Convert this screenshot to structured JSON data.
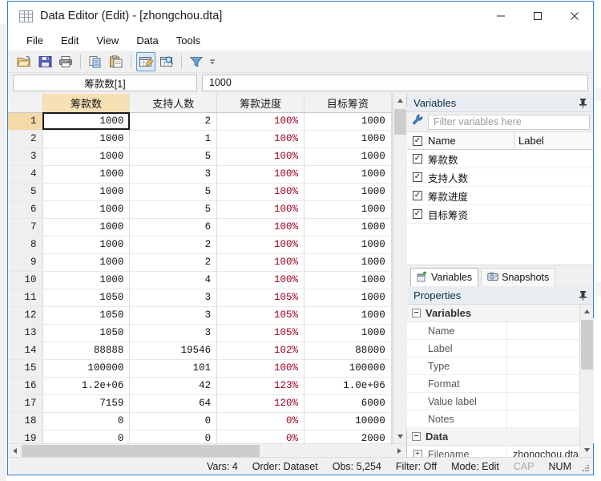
{
  "window": {
    "title": "Data Editor (Edit) - [zhongchou.dta]",
    "icon": "grid-icon",
    "controls": {
      "minimize": "—",
      "maximize": "□",
      "close": "✕"
    }
  },
  "menu": {
    "items": [
      "File",
      "Edit",
      "View",
      "Data",
      "Tools"
    ]
  },
  "toolbar": {
    "buttons": [
      {
        "name": "open-icon",
        "title": "Open"
      },
      {
        "name": "save-icon",
        "title": "Save"
      },
      {
        "name": "print-icon",
        "title": "Print"
      },
      {
        "name": "copy-icon",
        "title": "Copy"
      },
      {
        "name": "paste-icon",
        "title": "Paste"
      },
      {
        "name": "data-editor-edit-icon",
        "title": "Data Editor (Edit)"
      },
      {
        "name": "data-editor-browse-icon",
        "title": "Data Editor (Browse)"
      },
      {
        "name": "filter-icon",
        "title": "Filter"
      }
    ]
  },
  "cellbar": {
    "reference": "筹款数[1]",
    "value": "1000"
  },
  "grid": {
    "columns": [
      "筹款数",
      "支持人数",
      "筹款进度",
      "目标筹资"
    ],
    "selected_column_index": 0,
    "selected_row": 1,
    "rows": [
      {
        "n": "1",
        "c": [
          "1000",
          "2",
          "100%",
          "1000"
        ]
      },
      {
        "n": "2",
        "c": [
          "1000",
          "1",
          "100%",
          "1000"
        ]
      },
      {
        "n": "3",
        "c": [
          "1000",
          "5",
          "100%",
          "1000"
        ]
      },
      {
        "n": "4",
        "c": [
          "1000",
          "3",
          "100%",
          "1000"
        ]
      },
      {
        "n": "5",
        "c": [
          "1000",
          "5",
          "100%",
          "1000"
        ]
      },
      {
        "n": "6",
        "c": [
          "1000",
          "5",
          "100%",
          "1000"
        ]
      },
      {
        "n": "7",
        "c": [
          "1000",
          "6",
          "100%",
          "1000"
        ]
      },
      {
        "n": "8",
        "c": [
          "1000",
          "2",
          "100%",
          "1000"
        ]
      },
      {
        "n": "9",
        "c": [
          "1000",
          "2",
          "100%",
          "1000"
        ]
      },
      {
        "n": "10",
        "c": [
          "1000",
          "4",
          "100%",
          "1000"
        ]
      },
      {
        "n": "11",
        "c": [
          "1050",
          "3",
          "105%",
          "1000"
        ]
      },
      {
        "n": "12",
        "c": [
          "1050",
          "3",
          "105%",
          "1000"
        ]
      },
      {
        "n": "13",
        "c": [
          "1050",
          "3",
          "105%",
          "1000"
        ]
      },
      {
        "n": "14",
        "c": [
          "88888",
          "19546",
          "102%",
          "88000"
        ]
      },
      {
        "n": "15",
        "c": [
          "100000",
          "101",
          "100%",
          "100000"
        ]
      },
      {
        "n": "16",
        "c": [
          "1.2e+06",
          "42",
          "123%",
          "1.0e+06"
        ]
      },
      {
        "n": "17",
        "c": [
          "7159",
          "64",
          "120%",
          "6000"
        ]
      },
      {
        "n": "18",
        "c": [
          "0",
          "0",
          "0%",
          "10000"
        ]
      },
      {
        "n": "19",
        "c": [
          "0",
          "0",
          "0%",
          "2000"
        ]
      }
    ]
  },
  "variables_panel": {
    "title": "Variables",
    "filter_placeholder": "Filter variables here",
    "filter_value": "",
    "columns": {
      "name": "Name",
      "label": "Label"
    },
    "rows": [
      {
        "name": "筹款数",
        "label": "",
        "checked": true
      },
      {
        "name": "支持人数",
        "label": "",
        "checked": true
      },
      {
        "name": "筹款进度",
        "label": "",
        "checked": true
      },
      {
        "name": "目标筹资",
        "label": "",
        "checked": true
      }
    ]
  },
  "tabs": [
    {
      "label": "Variables",
      "icon": "variables-icon",
      "active": true
    },
    {
      "label": "Snapshots",
      "icon": "camera-icon",
      "active": false
    }
  ],
  "properties_panel": {
    "title": "Properties",
    "groups": [
      {
        "name": "Variables",
        "rows": [
          {
            "key": "Name",
            "value": ""
          },
          {
            "key": "Label",
            "value": ""
          },
          {
            "key": "Type",
            "value": ""
          },
          {
            "key": "Format",
            "value": ""
          },
          {
            "key": "Value label",
            "value": ""
          },
          {
            "key": "Notes",
            "value": ""
          }
        ]
      },
      {
        "name": "Data",
        "rows": [
          {
            "key": "Filename",
            "value": "zhongchou.dta",
            "expandable": true
          }
        ]
      }
    ]
  },
  "statusbar": {
    "vars": "Vars: 4",
    "order": "Order: Dataset",
    "obs": "Obs: 5,254",
    "filter": "Filter: Off",
    "mode": "Mode: Edit",
    "cap": "CAP",
    "num": "NUM"
  },
  "colors": {
    "accent": "#2f7fd0",
    "selection": "#f7e0b4",
    "percent_text": "#a00020",
    "panel_header": "#e9edf2"
  }
}
